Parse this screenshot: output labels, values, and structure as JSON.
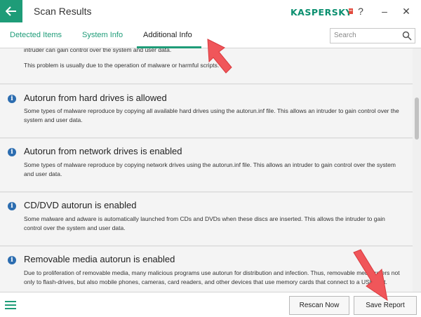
{
  "window": {
    "title": "Scan Results",
    "brand": "KASPERSKY",
    "brand_lab": "lab",
    "help": "?",
    "minimize": "–",
    "close": "✕"
  },
  "tabs": [
    {
      "label": "Detected Items"
    },
    {
      "label": "System Info"
    },
    {
      "label": "Additional Info"
    }
  ],
  "search": {
    "placeholder": "Search"
  },
  "cards": [
    {
      "title": "",
      "description": "intruder can gain control over the system and user data.",
      "extra": "This problem is usually due to the operation of malware or harmful scripts."
    },
    {
      "title": "Autorun from hard drives is allowed",
      "description": "Some types of malware reproduce by copying all available hard drives using the autorun.inf file. This allows an intruder to gain control over the system and user data."
    },
    {
      "title": "Autorun from network drives is enabled",
      "description": "Some types of malware reproduce by copying network drives using the autorun.inf file. This allows an intruder to gain control over the system and user data."
    },
    {
      "title": "CD/DVD autorun is enabled",
      "description": "Some malware and adware is automatically launched from CDs and DVDs when these discs are inserted. This allows the intruder to gain control over the system and user data."
    },
    {
      "title": "Removable media autorun is enabled",
      "description": "Due to proliferation of removable media, many malicious programs use autorun for distribution and infection. Thus, removable media refers not only to flash-drives, but also mobile phones, cameras, card readers, and other devices that use memory cards that connect to a USB port."
    }
  ],
  "icons": {
    "info": "i"
  },
  "footer": {
    "rescan_label": "Rescan Now",
    "save_label": "Save Report"
  },
  "colors": {
    "accent": "#1e9c78",
    "info_blue": "#2c6db0",
    "annotation_arrow": "#f0565a"
  }
}
